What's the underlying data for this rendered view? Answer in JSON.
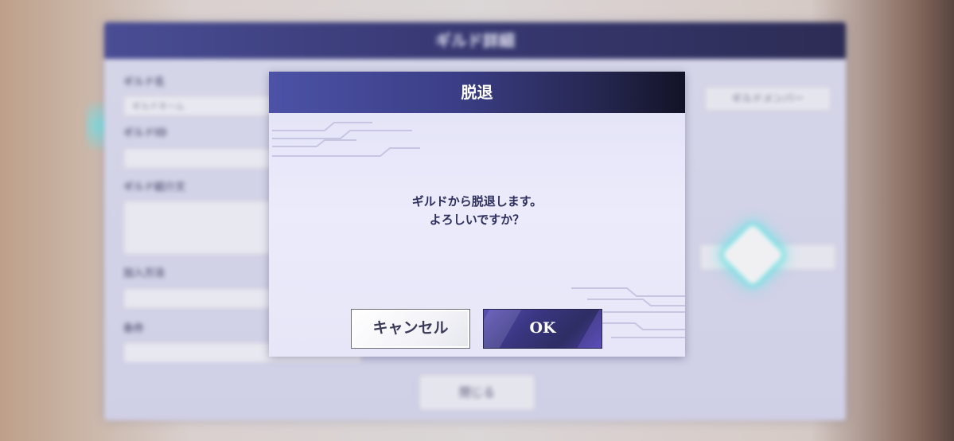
{
  "background": {
    "panel_title": "ギルド詳細",
    "labels": [
      "ギルド名",
      "ギルドID",
      "ギルド紹介文",
      "加入方法",
      "条件"
    ],
    "fields": [
      "ギルドネーム",
      "",
      "",
      "",
      ""
    ],
    "side_button": "ギルドメンバー",
    "close_button": "閉じる"
  },
  "dialog": {
    "title": "脱退",
    "message_line1": "ギルドから脱退します。",
    "message_line2": "よろしいですか？",
    "cancel_label": "キャンセル",
    "ok_label": "OK"
  },
  "colors": {
    "header_start": "#4c52a6",
    "header_end": "#121226",
    "ok_button": "#3b3784",
    "text": "#2e2e5e",
    "glow": "#78eaf0"
  }
}
